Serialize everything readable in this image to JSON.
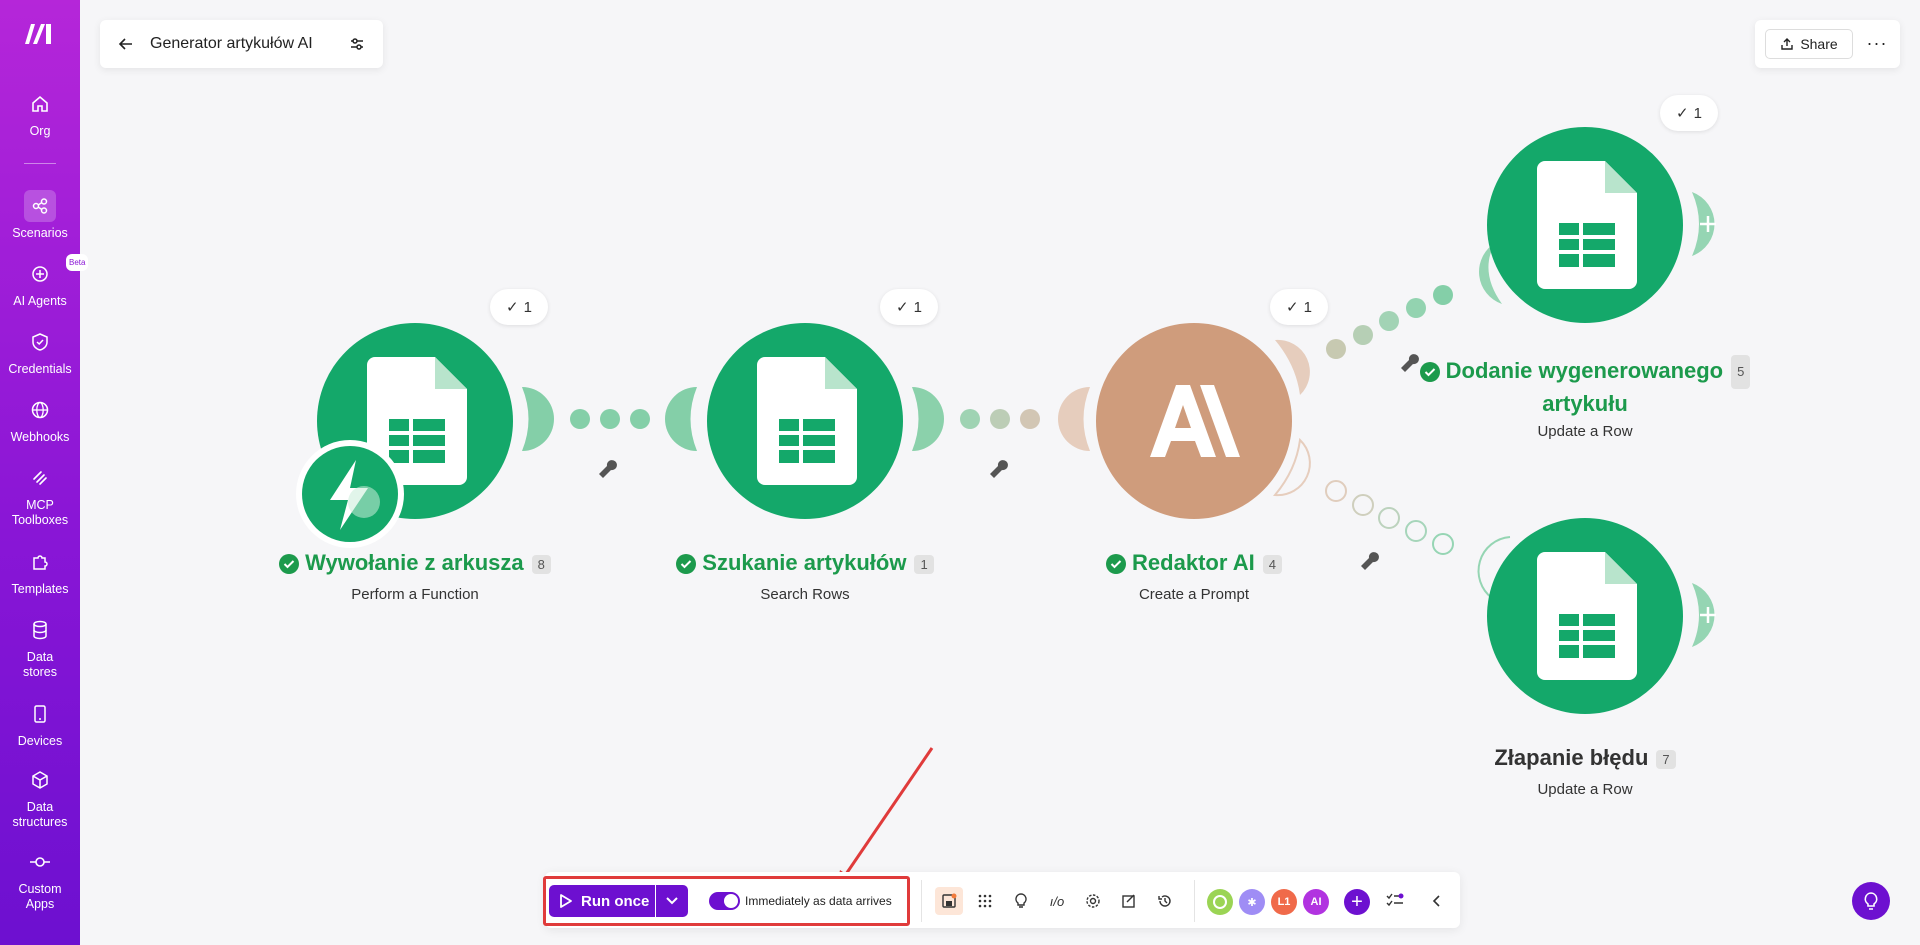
{
  "sidebar": {
    "items": [
      {
        "label": "Org",
        "icon": "home-icon"
      },
      {
        "label": "Scenarios",
        "icon": "scenarios-icon",
        "active": true
      },
      {
        "label": "AI Agents",
        "icon": "ai-agents-icon",
        "badge": "Beta"
      },
      {
        "label": "Credentials",
        "icon": "shield-icon"
      },
      {
        "label": "Webhooks",
        "icon": "globe-icon"
      },
      {
        "label": "MCP Toolboxes",
        "icon": "mcp-icon"
      },
      {
        "label": "Templates",
        "icon": "puzzle-icon"
      },
      {
        "label": "Data stores",
        "icon": "database-icon"
      },
      {
        "label": "Devices",
        "icon": "device-icon"
      },
      {
        "label": "Data structures",
        "icon": "cube-icon"
      },
      {
        "label": "Custom Apps",
        "icon": "custom-apps-icon"
      }
    ]
  },
  "header": {
    "title": "Generator artykułów AI",
    "share_label": "Share",
    "more_label": "···"
  },
  "modules": [
    {
      "name": "Wywołanie z arkusza",
      "count": "8",
      "subtitle": "Perform a Function",
      "ops": "1",
      "status": "success"
    },
    {
      "name": "Szukanie artykułów",
      "count": "1",
      "subtitle": "Search Rows",
      "ops": "1",
      "status": "success"
    },
    {
      "name": "Redaktor AI",
      "count": "4",
      "subtitle": "Create a Prompt",
      "ops": "1",
      "status": "success"
    },
    {
      "name_line1": "Dodanie wygenerowanego",
      "name_line2": "artykułu",
      "count": "5",
      "subtitle": "Update a Row",
      "ops": "1",
      "status": "success"
    },
    {
      "name": "Złapanie błędu",
      "count": "7",
      "subtitle": "Update a Row",
      "status": "none"
    }
  ],
  "toolbar": {
    "run_label": "Run once",
    "schedule_label": "Immediately as data arrives",
    "schedule_enabled": true,
    "app_badges": [
      "L1",
      "AI"
    ]
  },
  "colors": {
    "brand_purple": "#6d10d0",
    "sheets_green": "#14a86a",
    "ai_tan": "#cf9c7c",
    "success_green": "#1c9a4c",
    "highlight_red": "#e03b3b"
  }
}
